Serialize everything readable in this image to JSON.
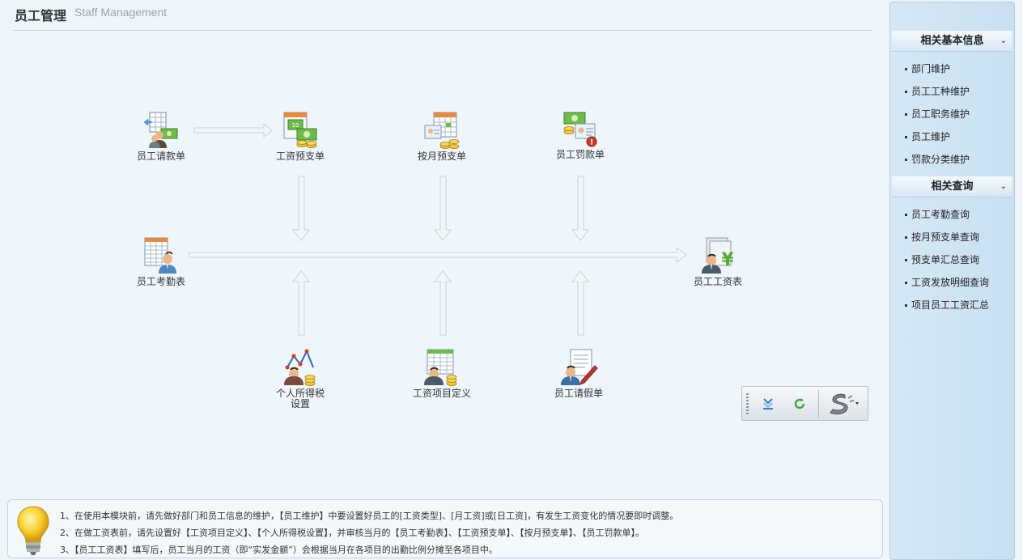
{
  "header": {
    "title": "员工管理",
    "subtitle": "Staff Management"
  },
  "nodes": {
    "leave_request": "员工请款单",
    "salary_advance": "工资预支单",
    "monthly_advance": "按月预支单",
    "penalty": "员工罚款单",
    "attendance": "员工考勤表",
    "payroll": "员工工资表",
    "income_tax": "个人所得税设置",
    "salary_items": "工资项目定义",
    "leave": "员工请假单"
  },
  "sidebar": {
    "section1": {
      "title": "相关基本信息",
      "items": [
        "部门维护",
        "员工工种维护",
        "员工职务维护",
        "员工维护",
        "罚款分类维护"
      ]
    },
    "section2": {
      "title": "相关查询",
      "items": [
        "员工考勤查询",
        "按月预支单查询",
        "预支单汇总查询",
        "工资发放明细查询",
        "项目员工工资汇总"
      ]
    }
  },
  "notes": [
    "1、在使用本模块前，请先做好部门和员工信息的维护，【员工维护】中要设置好员工的[工资类型]、[月工资]或[日工资]，有发生工资变化的情况要即时调整。",
    "2、在做工资表前，请先设置好【工资项目定义】、【个人所得税设置】，并审核当月的【员工考勤表】、【工资预支单】、【按月预支单】、【员工罚款单】。",
    "3、【员工工资表】填写后，员工当月的工资（即“实发金额”）会根据当月在各项目的出勤比例分摊至各项目中。"
  ],
  "colors": {
    "accent": "#2f8fd6",
    "arrow": "#dfe6ec",
    "arrow_border": "#c4ccd4"
  },
  "icons": [
    "leave-request-icon",
    "salary-advance-icon",
    "monthly-advance-icon",
    "penalty-icon",
    "attendance-icon",
    "payroll-icon",
    "income-tax-icon",
    "salary-items-icon",
    "leave-icon",
    "export-icon",
    "refresh-icon",
    "skin-icon",
    "bulb-icon"
  ]
}
